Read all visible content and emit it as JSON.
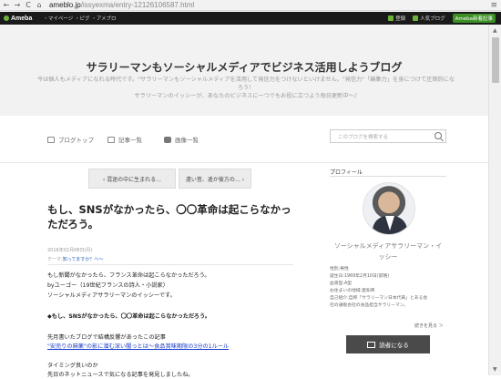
{
  "browser": {
    "back": "←",
    "forward": "→",
    "reload": "C",
    "home": "⌂",
    "url_host": "ameblo.jp",
    "url_path": "/issyexma/entry-12126106587.html",
    "menu": "≡"
  },
  "ameba_bar": {
    "logo": "Ameba",
    "links": "・マイページ ・ピグ ・アメブロ",
    "register": "登録",
    "blog_link": "人気ブログ",
    "ranking_link": "人気ブログ",
    "news": "Ameba新着記事"
  },
  "header": {
    "title": "サラリーマンもソーシャルメディアでビジネス活用しようブログ",
    "desc_line1": "今は個人もメディアになれる時代です。\"サラリーマンもソーシャルメディアを活用して発信力をつけないといけません。\"発信力\"「編集力」を身につけて圧倒的になろう！",
    "desc_line2": "サラリーマンのイッシーが、あなたのビジネスに一つでもお役に立つよう毎日更新中〜♪"
  },
  "nav": {
    "top": "ブログトップ",
    "entries": "記事一覧",
    "images": "画像一覧",
    "search_placeholder": "このブログを検索する"
  },
  "pager": {
    "prev": "混迷の中に生まれる…",
    "next": "遠い昔、遥か彼方の…"
  },
  "article": {
    "title": "もし、SNSがなかったら、〇〇革命は起こらなかっただろう。",
    "date": "2016年02月08日(月)",
    "theme_label": "テーマ:",
    "theme_link": "知ってますか？へ〜",
    "p1": "もし新聞がなかったら、フランス革命は起こらなかっただろう。",
    "p2": "byユーゴー（19世紀フランスの詩人・小説家）",
    "p3": "ソーシャルメディアサラリーマンのイッシーです。",
    "p4": "◆もし、SNSがなかったら、〇〇革命は起こらなかっただろう。",
    "p5": "先月書いたブログで結構反響があったこの記事",
    "p6": "\"安売りの麻薬\"の影に潜む深い闇っとは〜食品賞味期限の3分の1ルール",
    "p7": "タイミング良いのか",
    "p8": "先日のネットニュースで気になる記事を発見しましたね。"
  },
  "sidebar": {
    "heading": "プロフィール",
    "name_line1": "ソーシャルメディアサラリーマン・イ",
    "name_line2": "ッシー",
    "gender": "性別:男性",
    "birthday": "誕生日:1969年2月10日(前略)",
    "blood": "血液型:A型",
    "residence": "お住まいの地域:愛知県",
    "intro1": "自己紹介:自称「サラリーマン日本代表」とある会",
    "intro2": "社の通販会社の食品担当サラリーマン。",
    "more": "続きを見る ＞",
    "reader_button": "読者になる"
  }
}
